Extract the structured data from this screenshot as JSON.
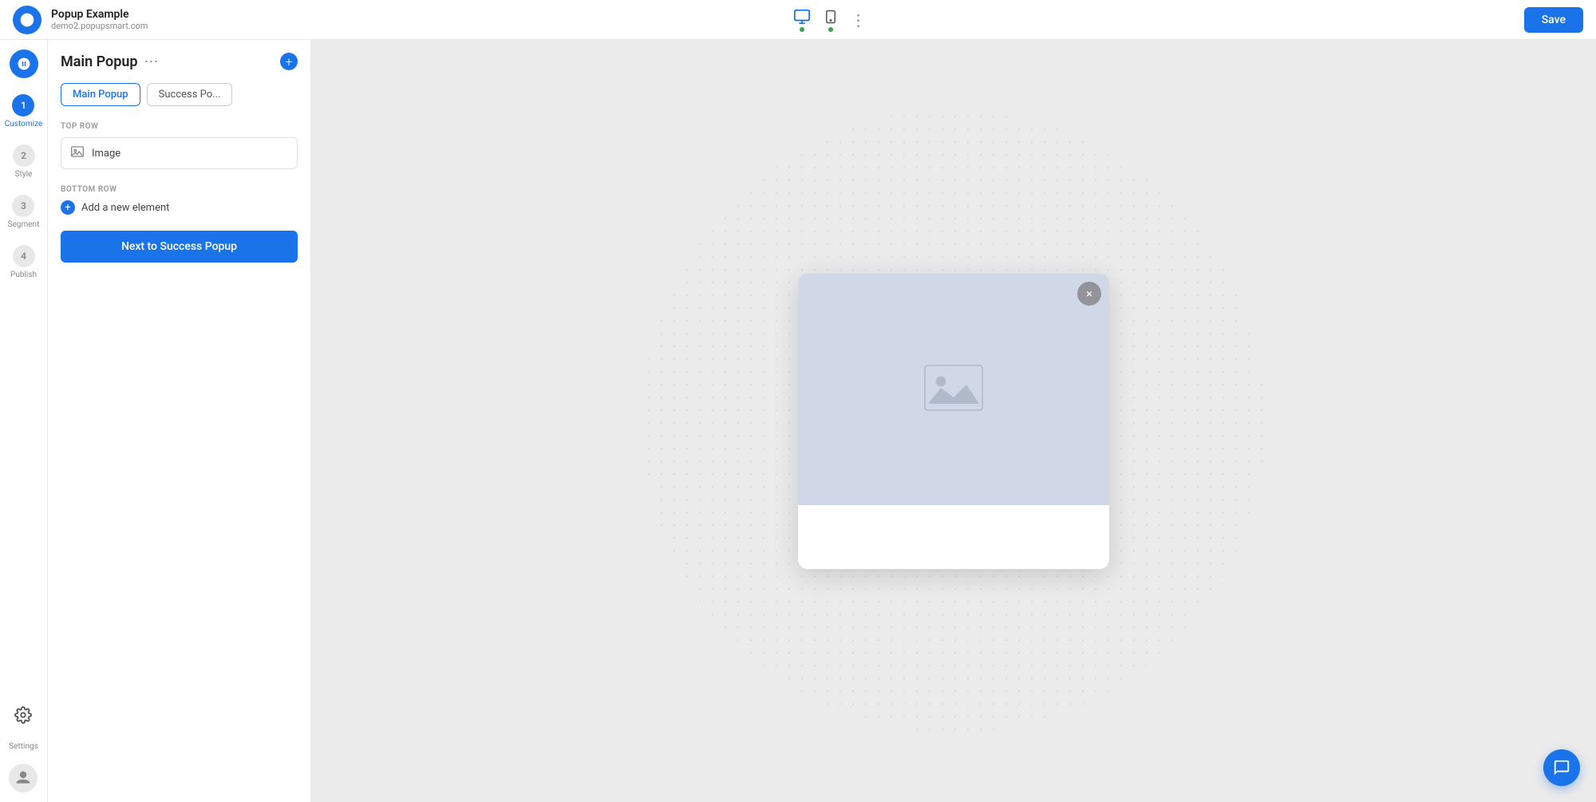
{
  "header": {
    "title": "Popup Example",
    "url": "demo2.popupsmart.com",
    "save_label": "Save"
  },
  "nav": {
    "steps": [
      {
        "number": "1",
        "label": "Customize",
        "active": true
      },
      {
        "number": "2",
        "label": "Style",
        "active": false
      },
      {
        "number": "3",
        "label": "Segment",
        "active": false
      },
      {
        "number": "4",
        "label": "Publish",
        "active": false
      }
    ]
  },
  "sidebar": {
    "title": "Main Popup",
    "tabs": [
      {
        "label": "Main Popup",
        "active": true
      },
      {
        "label": "Success Po...",
        "active": false
      }
    ],
    "top_row_label": "TOP ROW",
    "top_row_item": "Image",
    "bottom_row_label": "BOTTOM ROW",
    "add_element_label": "Add a new element",
    "next_button_label": "Next to Success Popup"
  },
  "popup": {
    "close_label": "×"
  },
  "chat_icon": "💬"
}
